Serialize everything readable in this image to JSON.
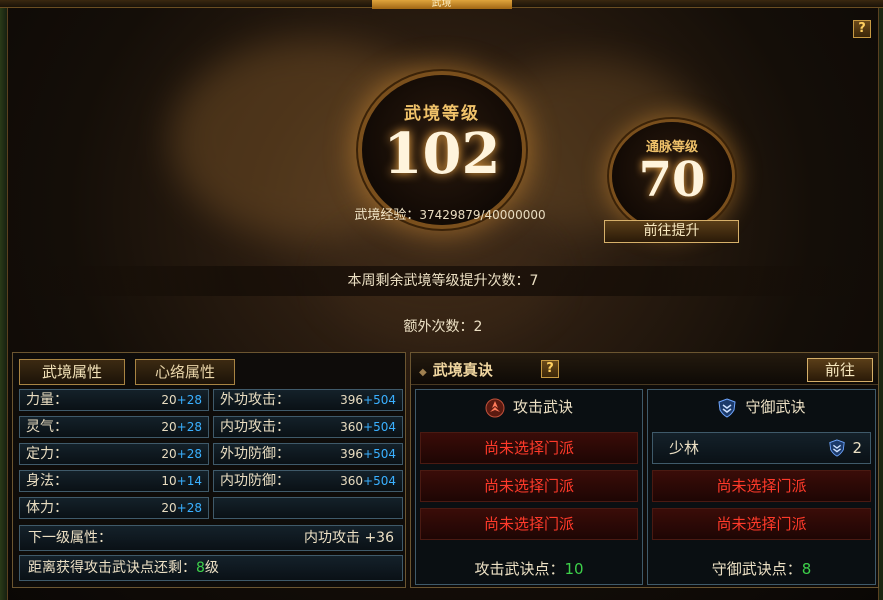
{
  "top": {
    "title": "武境"
  },
  "help_label": "?",
  "realm": {
    "level_label": "武境等级",
    "level_value": "102",
    "meridian_label": "通脉等级",
    "meridian_value": "70",
    "exp_label": "武境经验：",
    "exp_value": "37429879/40000000",
    "goto_levelup": "前往提升",
    "weekly_text": "本周剩余武境等级提升次数：7",
    "extra_text": "额外次数：2"
  },
  "left_panel": {
    "tabs": [
      "武境属性",
      "心络属性"
    ],
    "stats_left": [
      {
        "label": "力量：",
        "base": "20",
        "add": "+28"
      },
      {
        "label": "灵气：",
        "base": "20",
        "add": "+28"
      },
      {
        "label": "定力：",
        "base": "20",
        "add": "+28"
      },
      {
        "label": "身法：",
        "base": "10",
        "add": "+14"
      },
      {
        "label": "体力：",
        "base": "20",
        "add": "+28"
      }
    ],
    "stats_right": [
      {
        "label": "外功攻击：",
        "base": "396",
        "add": "+504"
      },
      {
        "label": "内功攻击：",
        "base": "360",
        "add": "+504"
      },
      {
        "label": "外功防御：",
        "base": "396",
        "add": "+504"
      },
      {
        "label": "内功防御：",
        "base": "360",
        "add": "+504"
      }
    ],
    "next_label": "下一级属性：",
    "next_value": "内功攻击  +36",
    "distance_label": "距离获得攻击武诀点还剩：",
    "distance_value": "8",
    "distance_unit": "级"
  },
  "right_panel": {
    "title": "武境真诀",
    "goto": "前往",
    "attack": {
      "header": "攻击武诀",
      "slots": [
        "尚未选择门派",
        "尚未选择门派",
        "尚未选择门派"
      ],
      "points_label": "攻击武诀点：",
      "points_value": "10"
    },
    "defense": {
      "header": "守御武诀",
      "set_name": "少林",
      "set_count": "2",
      "slots": [
        "尚未选择门派",
        "尚未选择门派"
      ],
      "points_label": "守御武诀点：",
      "points_value": "8"
    }
  },
  "colors": {
    "accent_gold": "#f0c26a",
    "stat_add_blue": "#3ab0ff",
    "warn_red": "#ff3a2a",
    "green": "#3dd04a"
  }
}
